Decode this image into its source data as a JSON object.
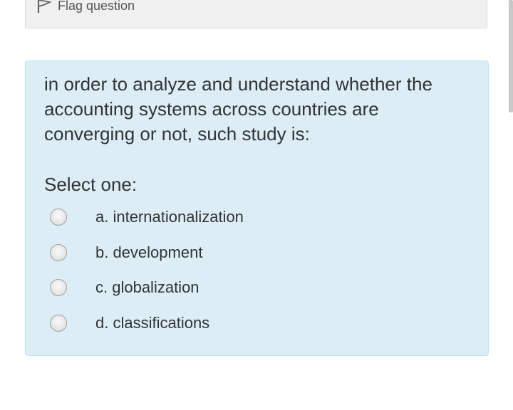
{
  "flag": {
    "label": "Flag question",
    "icon": "flag-icon"
  },
  "question": {
    "text_lines": [
      "in order to analyze and understand whether the",
      "accounting systems across countries are",
      "converging or not, such study is:"
    ],
    "prompt": "Select one:",
    "options": [
      {
        "label": "a. internationalization",
        "selected": false
      },
      {
        "label": "b. development",
        "selected": false
      },
      {
        "label": "c. globalization",
        "selected": false
      },
      {
        "label": "d. classifications",
        "selected": false
      }
    ]
  },
  "colors": {
    "formulation_bg": "#dcedf6",
    "formulation_border": "#c3e2f0",
    "info_bg": "#f0f0f0",
    "text": "#333333"
  }
}
